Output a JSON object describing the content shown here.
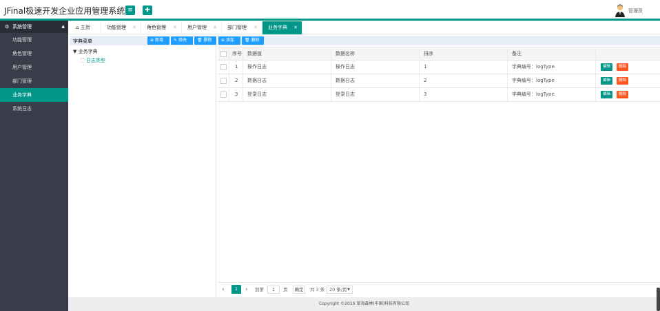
{
  "header": {
    "title": "JFinal极速开发企业应用管理系统",
    "menu_icon": "≡",
    "add_icon": "✚",
    "user_label": "管理员",
    "accent": "#009688"
  },
  "sidebar": {
    "group_label": "系统管理",
    "items": [
      {
        "label": "功能管理"
      },
      {
        "label": "角色管理"
      },
      {
        "label": "用户管理"
      },
      {
        "label": "部门管理"
      },
      {
        "label": "业务字典"
      },
      {
        "label": "系统日志"
      }
    ]
  },
  "tabs": [
    {
      "label": "主页"
    },
    {
      "label": "功能管理"
    },
    {
      "label": "角色管理"
    },
    {
      "label": "用户管理"
    },
    {
      "label": "部门管理"
    },
    {
      "label": "业务字典"
    }
  ],
  "tab_close": "✕",
  "left_panel": {
    "title": "字典菜单",
    "btn_new": "新增",
    "btn_edit": "修改",
    "btn_delete": "删除",
    "tree_root": "业务字典",
    "tree_child": "日志类型"
  },
  "right_panel": {
    "btn_add": "添加",
    "btn_delete": "删除",
    "columns": {
      "seq": "序号",
      "value": "数据值",
      "name": "数据名称",
      "sort": "排序",
      "note": "备注"
    },
    "rows": [
      {
        "seq": "1",
        "value": "操作日志",
        "name": "操作日志",
        "sort": "1",
        "note": "字典编号：logType"
      },
      {
        "seq": "2",
        "value": "数据日志",
        "name": "数据日志",
        "sort": "2",
        "note": "字典编号：logType"
      },
      {
        "seq": "3",
        "value": "登录日志",
        "name": "登录日志",
        "sort": "3",
        "note": "字典编号：logType"
      }
    ],
    "row_edit": "编辑",
    "row_delete": "删除"
  },
  "pager": {
    "prev": "‹",
    "current": "1",
    "next": "›",
    "goto_label": "到第",
    "goto_value": "1",
    "page_unit": "页",
    "confirm": "确定",
    "total": "共 3 条",
    "page_size": "20 条/页"
  },
  "footer": {
    "text": "Copyright ©2019 草海森林(中国)科技有限公司"
  }
}
